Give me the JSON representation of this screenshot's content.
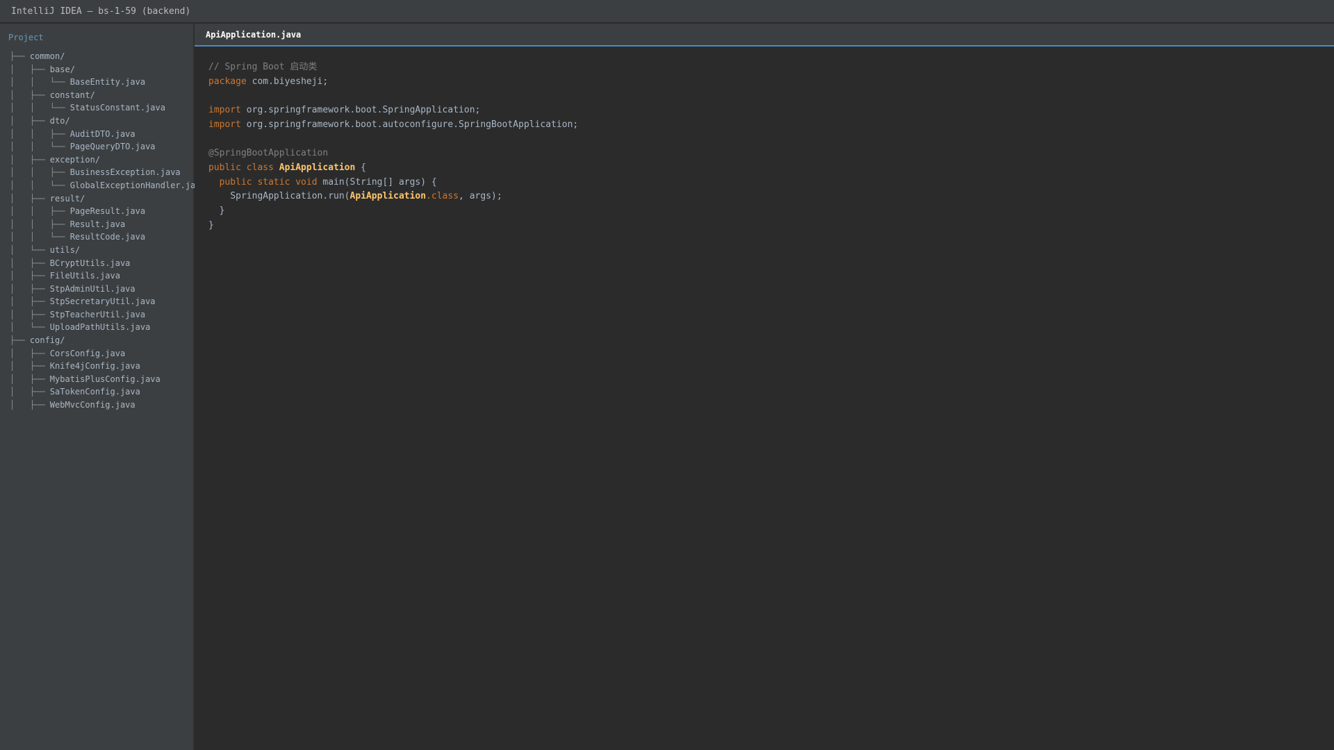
{
  "window": {
    "title": "IntelliJ IDEA — bs-1-59 (backend)"
  },
  "sidebar": {
    "panel_title": "Project",
    "tree": [
      {
        "prefix": "├── ",
        "label": "common/"
      },
      {
        "prefix": "│   ├── ",
        "label": "base/"
      },
      {
        "prefix": "│   │   └── ",
        "label": "BaseEntity.java"
      },
      {
        "prefix": "│   ├── ",
        "label": "constant/"
      },
      {
        "prefix": "│   │   └── ",
        "label": "StatusConstant.java"
      },
      {
        "prefix": "│   ├── ",
        "label": "dto/"
      },
      {
        "prefix": "│   │   ├── ",
        "label": "AuditDTO.java"
      },
      {
        "prefix": "│   │   └── ",
        "label": "PageQueryDTO.java"
      },
      {
        "prefix": "│   ├── ",
        "label": "exception/"
      },
      {
        "prefix": "│   │   ├── ",
        "label": "BusinessException.java"
      },
      {
        "prefix": "│   │   └── ",
        "label": "GlobalExceptionHandler.java"
      },
      {
        "prefix": "│   ├── ",
        "label": "result/"
      },
      {
        "prefix": "│   │   ├── ",
        "label": "PageResult.java"
      },
      {
        "prefix": "│   │   ├── ",
        "label": "Result.java"
      },
      {
        "prefix": "│   │   └── ",
        "label": "ResultCode.java"
      },
      {
        "prefix": "│   └── ",
        "label": "utils/"
      },
      {
        "prefix": "│   ├── ",
        "label": "BCryptUtils.java"
      },
      {
        "prefix": "│   ├── ",
        "label": "FileUtils.java"
      },
      {
        "prefix": "│   ├── ",
        "label": "StpAdminUtil.java"
      },
      {
        "prefix": "│   ├── ",
        "label": "StpSecretaryUtil.java"
      },
      {
        "prefix": "│   ├── ",
        "label": "StpTeacherUtil.java"
      },
      {
        "prefix": "│   └── ",
        "label": "UploadPathUtils.java"
      },
      {
        "prefix": "├── ",
        "label": "config/"
      },
      {
        "prefix": "│   ├── ",
        "label": "CorsConfig.java"
      },
      {
        "prefix": "│   ├── ",
        "label": "Knife4jConfig.java"
      },
      {
        "prefix": "│   ├── ",
        "label": "MybatisPlusConfig.java"
      },
      {
        "prefix": "│   ├── ",
        "label": "SaTokenConfig.java"
      },
      {
        "prefix": "│   ├── ",
        "label": "WebMvcConfig.java"
      }
    ]
  },
  "editor": {
    "active_tab": "ApiApplication.java",
    "code": {
      "l1": {
        "comment": "// Spring Boot 启动类"
      },
      "l2": {
        "kw": "package",
        "rest": " com.biyesheji;"
      },
      "l4": {
        "kw": "import",
        "rest": " org.springframework.boot.SpringApplication;"
      },
      "l5": {
        "kw": "import",
        "rest": " org.springframework.boot.autoconfigure.SpringBootApplication;"
      },
      "l7": {
        "annotation": "@SpringBootApplication"
      },
      "l8": {
        "kw": "public class",
        "cls": "ApiApplication",
        "rest": " {"
      },
      "l9": {
        "indent": "  ",
        "kw": "public static void",
        "rest": " main(String[] args) {"
      },
      "l10": {
        "indent": "    ",
        "pre": "SpringApplication.run(",
        "cls": "ApiApplication",
        "kw": ".class",
        "rest": ", args);"
      },
      "l11": {
        "text": "  }"
      },
      "l12": {
        "text": "}"
      }
    }
  },
  "colors": {
    "background": "#2b2b2b",
    "panel": "#3c3f41",
    "keyword": "#cc7832",
    "class_name": "#ffc66d",
    "comment": "#808080",
    "text": "#a9b7c6",
    "accent": "#4a88c7"
  }
}
